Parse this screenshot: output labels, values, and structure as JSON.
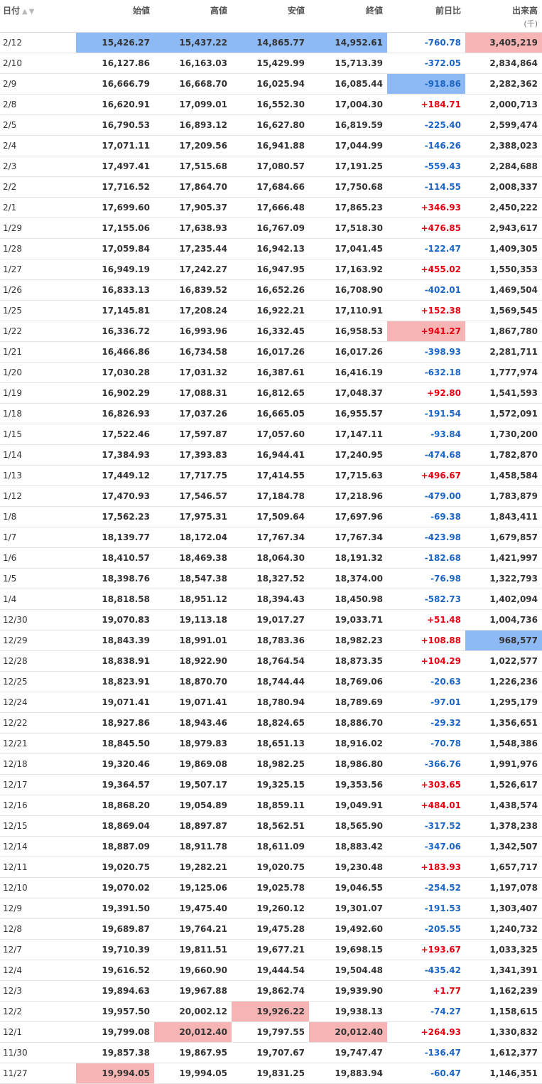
{
  "headers": {
    "date": "日付",
    "open": "始値",
    "high": "高値",
    "low": "安値",
    "close": "終値",
    "change": "前日比",
    "volume": "出来高",
    "volume_unit": "(千)"
  },
  "colors": {
    "up": "#e60012",
    "down": "#1c65c4",
    "highlight_blue": "#8db9f5",
    "highlight_red": "#f6b4b4"
  },
  "rows": [
    [
      "2/12",
      "15,426.27",
      "15,437.22",
      "14,865.77",
      "14,952.61",
      "-760.78",
      "3,405,219"
    ],
    [
      "2/10",
      "16,127.86",
      "16,163.03",
      "15,429.99",
      "15,713.39",
      "-372.05",
      "2,834,864"
    ],
    [
      "2/9",
      "16,666.79",
      "16,668.70",
      "16,025.94",
      "16,085.44",
      "-918.86",
      "2,282,362"
    ],
    [
      "2/8",
      "16,620.91",
      "17,099.01",
      "16,552.30",
      "17,004.30",
      "+184.71",
      "2,000,713"
    ],
    [
      "2/5",
      "16,790.53",
      "16,893.12",
      "16,627.80",
      "16,819.59",
      "-225.40",
      "2,599,474"
    ],
    [
      "2/4",
      "17,071.11",
      "17,209.56",
      "16,941.88",
      "17,044.99",
      "-146.26",
      "2,388,023"
    ],
    [
      "2/3",
      "17,497.41",
      "17,515.68",
      "17,080.57",
      "17,191.25",
      "-559.43",
      "2,284,688"
    ],
    [
      "2/2",
      "17,716.52",
      "17,864.70",
      "17,684.66",
      "17,750.68",
      "-114.55",
      "2,008,337"
    ],
    [
      "2/1",
      "17,699.60",
      "17,905.37",
      "17,666.48",
      "17,865.23",
      "+346.93",
      "2,450,222"
    ],
    [
      "1/29",
      "17,155.06",
      "17,638.93",
      "16,767.09",
      "17,518.30",
      "+476.85",
      "2,943,617"
    ],
    [
      "1/28",
      "17,059.84",
      "17,235.44",
      "16,942.13",
      "17,041.45",
      "-122.47",
      "1,409,305"
    ],
    [
      "1/27",
      "16,949.19",
      "17,242.27",
      "16,947.95",
      "17,163.92",
      "+455.02",
      "1,550,353"
    ],
    [
      "1/26",
      "16,833.13",
      "16,839.52",
      "16,652.26",
      "16,708.90",
      "-402.01",
      "1,469,504"
    ],
    [
      "1/25",
      "17,145.81",
      "17,208.24",
      "16,922.21",
      "17,110.91",
      "+152.38",
      "1,569,545"
    ],
    [
      "1/22",
      "16,336.72",
      "16,993.96",
      "16,332.45",
      "16,958.53",
      "+941.27",
      "1,867,780"
    ],
    [
      "1/21",
      "16,466.86",
      "16,734.58",
      "16,017.26",
      "16,017.26",
      "-398.93",
      "2,281,711"
    ],
    [
      "1/20",
      "17,030.28",
      "17,031.32",
      "16,387.61",
      "16,416.19",
      "-632.18",
      "1,777,974"
    ],
    [
      "1/19",
      "16,902.29",
      "17,088.31",
      "16,812.65",
      "17,048.37",
      "+92.80",
      "1,541,593"
    ],
    [
      "1/18",
      "16,826.93",
      "17,037.26",
      "16,665.05",
      "16,955.57",
      "-191.54",
      "1,572,091"
    ],
    [
      "1/15",
      "17,522.46",
      "17,597.87",
      "17,057.60",
      "17,147.11",
      "-93.84",
      "1,730,200"
    ],
    [
      "1/14",
      "17,384.93",
      "17,393.83",
      "16,944.41",
      "17,240.95",
      "-474.68",
      "1,782,870"
    ],
    [
      "1/13",
      "17,449.12",
      "17,717.75",
      "17,414.55",
      "17,715.63",
      "+496.67",
      "1,458,584"
    ],
    [
      "1/12",
      "17,470.93",
      "17,546.57",
      "17,184.78",
      "17,218.96",
      "-479.00",
      "1,783,879"
    ],
    [
      "1/8",
      "17,562.23",
      "17,975.31",
      "17,509.64",
      "17,697.96",
      "-69.38",
      "1,843,411"
    ],
    [
      "1/7",
      "18,139.77",
      "18,172.04",
      "17,767.34",
      "17,767.34",
      "-423.98",
      "1,679,857"
    ],
    [
      "1/6",
      "18,410.57",
      "18,469.38",
      "18,064.30",
      "18,191.32",
      "-182.68",
      "1,421,997"
    ],
    [
      "1/5",
      "18,398.76",
      "18,547.38",
      "18,327.52",
      "18,374.00",
      "-76.98",
      "1,322,793"
    ],
    [
      "1/4",
      "18,818.58",
      "18,951.12",
      "18,394.43",
      "18,450.98",
      "-582.73",
      "1,402,094"
    ],
    [
      "12/30",
      "19,070.83",
      "19,113.18",
      "19,017.27",
      "19,033.71",
      "+51.48",
      "1,004,736"
    ],
    [
      "12/29",
      "18,843.39",
      "18,991.01",
      "18,783.36",
      "18,982.23",
      "+108.88",
      "968,577"
    ],
    [
      "12/28",
      "18,838.91",
      "18,922.90",
      "18,764.54",
      "18,873.35",
      "+104.29",
      "1,022,577"
    ],
    [
      "12/25",
      "18,823.91",
      "18,870.70",
      "18,744.44",
      "18,769.06",
      "-20.63",
      "1,226,236"
    ],
    [
      "12/24",
      "19,071.41",
      "19,071.41",
      "18,780.94",
      "18,789.69",
      "-97.01",
      "1,295,179"
    ],
    [
      "12/22",
      "18,927.86",
      "18,943.46",
      "18,824.65",
      "18,886.70",
      "-29.32",
      "1,356,651"
    ],
    [
      "12/21",
      "18,845.50",
      "18,979.83",
      "18,651.13",
      "18,916.02",
      "-70.78",
      "1,548,386"
    ],
    [
      "12/18",
      "19,320.46",
      "19,869.08",
      "18,982.25",
      "18,986.80",
      "-366.76",
      "1,991,976"
    ],
    [
      "12/17",
      "19,364.57",
      "19,507.17",
      "19,325.15",
      "19,353.56",
      "+303.65",
      "1,526,617"
    ],
    [
      "12/16",
      "18,868.20",
      "19,054.89",
      "18,859.11",
      "19,049.91",
      "+484.01",
      "1,438,574"
    ],
    [
      "12/15",
      "18,869.04",
      "18,897.87",
      "18,562.51",
      "18,565.90",
      "-317.52",
      "1,378,238"
    ],
    [
      "12/14",
      "18,887.09",
      "18,911.78",
      "18,611.09",
      "18,883.42",
      "-347.06",
      "1,342,507"
    ],
    [
      "12/11",
      "19,020.75",
      "19,282.21",
      "19,020.75",
      "19,230.48",
      "+183.93",
      "1,657,717"
    ],
    [
      "12/10",
      "19,070.02",
      "19,125.06",
      "19,025.78",
      "19,046.55",
      "-254.52",
      "1,197,078"
    ],
    [
      "12/9",
      "19,391.50",
      "19,475.40",
      "19,260.12",
      "19,301.07",
      "-191.53",
      "1,303,407"
    ],
    [
      "12/8",
      "19,689.87",
      "19,764.21",
      "19,475.28",
      "19,492.60",
      "-205.55",
      "1,240,732"
    ],
    [
      "12/7",
      "19,710.39",
      "19,811.51",
      "19,677.21",
      "19,698.15",
      "+193.67",
      "1,033,325"
    ],
    [
      "12/4",
      "19,616.52",
      "19,660.90",
      "19,444.54",
      "19,504.48",
      "-435.42",
      "1,341,391"
    ],
    [
      "12/3",
      "19,894.63",
      "19,967.88",
      "19,862.74",
      "19,939.90",
      "+1.77",
      "1,162,239"
    ],
    [
      "12/2",
      "19,957.50",
      "20,002.12",
      "19,926.22",
      "19,938.13",
      "-74.27",
      "1,158,615"
    ],
    [
      "12/1",
      "19,799.08",
      "20,012.40",
      "19,797.55",
      "20,012.40",
      "+264.93",
      "1,330,832"
    ],
    [
      "11/30",
      "19,857.38",
      "19,867.95",
      "19,707.67",
      "19,747.47",
      "-136.47",
      "1,612,377"
    ],
    [
      "11/27",
      "19,994.05",
      "19,994.05",
      "19,831.25",
      "19,883.94",
      "-60.47",
      "1,146,351"
    ]
  ],
  "highlights": [
    {
      "row": 0,
      "col": 1,
      "color": "blue"
    },
    {
      "row": 0,
      "col": 2,
      "color": "blue"
    },
    {
      "row": 0,
      "col": 3,
      "color": "blue"
    },
    {
      "row": 0,
      "col": 4,
      "color": "blue"
    },
    {
      "row": 0,
      "col": 6,
      "color": "red"
    },
    {
      "row": 2,
      "col": 5,
      "color": "blue"
    },
    {
      "row": 14,
      "col": 5,
      "color": "red"
    },
    {
      "row": 29,
      "col": 6,
      "color": "blue"
    },
    {
      "row": 47,
      "col": 3,
      "color": "red"
    },
    {
      "row": 48,
      "col": 2,
      "color": "red"
    },
    {
      "row": 48,
      "col": 4,
      "color": "red"
    },
    {
      "row": 50,
      "col": 1,
      "color": "red"
    }
  ]
}
